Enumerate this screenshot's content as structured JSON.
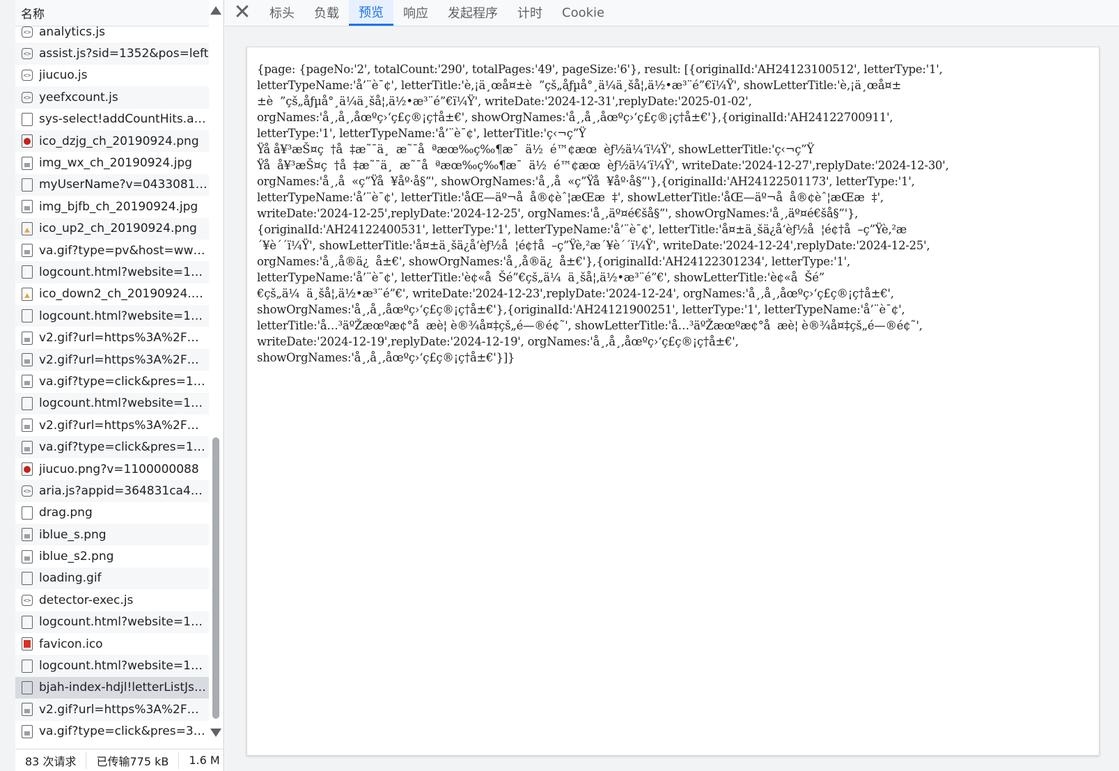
{
  "network": {
    "column_header": "名称",
    "requests": [
      {
        "name": "analytics.js",
        "icon": "script-icon",
        "type": "script"
      },
      {
        "name": "assist.js?sid=1352&pos=left",
        "icon": "script-icon",
        "type": "script"
      },
      {
        "name": "jiucuo.js",
        "icon": "script-icon",
        "type": "script"
      },
      {
        "name": "yeefxcount.js",
        "icon": "script-icon",
        "type": "script"
      },
      {
        "name": "sys-select!addCountHits.acti...",
        "icon": "document-icon",
        "type": "doc"
      },
      {
        "name": "ico_dzjg_ch_20190924.png",
        "icon": "image-icon",
        "type": "img-red"
      },
      {
        "name": "img_wx_ch_20190924.jpg",
        "icon": "image-icon",
        "type": "img"
      },
      {
        "name": "myUserName?v=043308105...",
        "icon": "document-icon",
        "type": "doc"
      },
      {
        "name": "img_bjfb_ch_20190924.jpg",
        "icon": "image-icon",
        "type": "img"
      },
      {
        "name": "ico_up2_ch_20190924.png",
        "icon": "image-icon",
        "type": "img-gold"
      },
      {
        "name": "va.gif?type=pv&host=www....",
        "icon": "image-icon",
        "type": "img"
      },
      {
        "name": "logcount.html?website=100...",
        "icon": "document-icon",
        "type": "doc"
      },
      {
        "name": "ico_down2_ch_20190924.png",
        "icon": "image-icon",
        "type": "img-gold"
      },
      {
        "name": "logcount.html?website=100...",
        "icon": "document-icon",
        "type": "doc"
      },
      {
        "name": "v2.gif?url=https%3A%2F%2...",
        "icon": "image-icon",
        "type": "img"
      },
      {
        "name": "v2.gif?url=https%3A%2F%2...",
        "icon": "image-icon",
        "type": "img"
      },
      {
        "name": "va.gif?type=click&pres=123...",
        "icon": "image-icon",
        "type": "img"
      },
      {
        "name": "logcount.html?website=100...",
        "icon": "document-icon",
        "type": "doc"
      },
      {
        "name": "v2.gif?url=https%3A%2F%2...",
        "icon": "image-icon",
        "type": "img"
      },
      {
        "name": "va.gif?type=click&pres=123...",
        "icon": "image-icon",
        "type": "img"
      },
      {
        "name": "jiucuo.png?v=1100000088",
        "icon": "image-icon",
        "type": "img-red"
      },
      {
        "name": "aria.js?appid=364831ca496...",
        "icon": "script-icon",
        "type": "script"
      },
      {
        "name": "drag.png",
        "icon": "image-icon",
        "type": "doc"
      },
      {
        "name": "iblue_s.png",
        "icon": "image-icon",
        "type": "img"
      },
      {
        "name": "iblue_s2.png",
        "icon": "image-icon",
        "type": "img"
      },
      {
        "name": "loading.gif",
        "icon": "image-icon",
        "type": "doc"
      },
      {
        "name": "detector-exec.js",
        "icon": "script-icon",
        "type": "script"
      },
      {
        "name": "logcount.html?website=100...",
        "icon": "document-icon",
        "type": "doc"
      },
      {
        "name": "favicon.ico",
        "icon": "image-icon",
        "type": "ico-red"
      },
      {
        "name": "logcount.html?website=100...",
        "icon": "document-icon",
        "type": "doc"
      },
      {
        "name": "bjah-index-hdjl!letterListJso...",
        "icon": "document-icon",
        "type": "doc",
        "selected": true
      },
      {
        "name": "v2.gif?url=https%3A%2F%2...",
        "icon": "image-icon",
        "type": "img"
      },
      {
        "name": "va.gif?type=click&pres=397...",
        "icon": "image-icon",
        "type": "img"
      }
    ],
    "status": {
      "requests": "83 次请求",
      "transferred": "已传输775 kB",
      "resources": "1.6 M"
    }
  },
  "detail": {
    "close_icon": "close-icon",
    "tabs": [
      "标头",
      "负载",
      "预览",
      "响应",
      "发起程序",
      "计时",
      "Cookie"
    ],
    "active_tab": "预览",
    "preview_lines": [
      "{page: {pageNo:'2', totalCount:'290', totalPages:'49', pageSize:'6'}, result: [{originalId:'AH24123100512', letterType:'1',",
      "letterTypeName:'å’¨è¯¢', letterTitle:'è‚¡ä¸œå¤±è  ”çš„åƒµå°¸ä¼ä¸šå¦‚ä½•æ³¨é”€ï¼Ÿ', showLetterTitle:'è‚¡ä¸œå¤±",
      "±è  ”çš„åƒµå°¸ä¼ä¸šå¦‚ä½•æ³¨é”€ï¼Ÿ', writeDate:'2024-12-31',replyDate:'2025-01-02',",
      "orgNames:'å¸‚å¸‚åœºç›‘ç£ç®¡ç†å±€', showOrgNames:'å¸‚å¸‚åœºç›‘ç£ç®¡ç†å±€'},{originalId:'AH24122700911',",
      "letterType:'1', letterTypeName:'å’¨è¯¢', letterTitle:'ç‹¬ç”Ÿ",
      "Ÿå å¥³æŠ¤ç  †å  ‡æ˜¯ä¸  æ˜¯å  ªæœ‰ç‰¶æ¯  ä½  é™¢æœ  èƒ½ä¼‘ï¼Ÿ', showLetterTitle:'ç‹¬ç”Ÿ",
      "Ÿå  å¥³æŠ¤ç  †å  ‡æ˜¯ä¸  æ˜¯å  ªæœ‰ç‰¶æ¯  ä½  é™¢æœ  èƒ½ä¼‘ï¼Ÿ', writeDate:'2024-12-27',replyDate:'2024-12-30',",
      "orgNames:'å¸‚å  «ç”Ÿå  ¥åº·å§”', showOrgNames:'å¸‚å  «ç”Ÿå  ¥åº·å§”'},{originalId:'AH24122501173', letterType:'1',",
      "letterTypeName:'å’¨è¯¢', letterTitle:'åŒ—äº¬å  å®¢èˆ¦æŒæ  ‡', showLetterTitle:'åŒ—äº¬å  å®¢èˆ¦æŒæ  ‡',",
      "writeDate:'2024-12-25',replyDate:'2024-12-25', orgNames:'å¸‚äº¤é€šå§”', showOrgNames:'å¸‚äº¤é€šå§”'},",
      "{originalId:'AH24122400531', letterType:'1', letterTypeName:'å’¨è¯¢', letterTitle:'å¤±ä¸šä¿å‘èƒ½å  ¦é¢†å  –ç”Ÿè‚²æ",
      "´¥è´´ï¼Ÿ', showLetterTitle:'å¤±ä¸šä¿å‘èƒ½å  ¦é¢†å  –ç”Ÿè‚²æ´¥è´´ï¼Ÿ', writeDate:'2024-12-24',replyDate:'2024-12-25',",
      "orgNames:'å¸‚å®ä¿  å±€', showOrgNames:'å¸‚å®ä¿  å±€'},{originalId:'AH24122301234', letterType:'1',",
      "letterTypeName:'å’¨è¯¢', letterTitle:'è¢«å  Šé”€çš„ä¼  ä¸šå¦‚ä½•æ³¨é”€', showLetterTitle:'è¢«å  Šé”",
      "€çš„ä¼  ä¸šå¦‚ä½•æ³¨é”€', writeDate:'2024-12-23',replyDate:'2024-12-24', orgNames:'å¸‚å¸‚åœºç›‘ç£ç®¡ç†å±€',",
      "showOrgNames:'å¸‚å¸‚åœºç›‘ç£ç®¡ç†å±€'},{originalId:'AH24121900251', letterType:'1', letterTypeName:'å’¨è¯¢',",
      "letterTitle:'å…³äºŽæœºæ¢°å  æè¦ è®¾å¤‡çš„é—®é¢˜', showLetterTitle:'å…³äºŽæœºæ¢°å  æè¦ è®¾å¤‡çš„é—®é¢˜',",
      "writeDate:'2024-12-19',replyDate:'2024-12-19', orgNames:'å¸‚å¸‚åœºç›‘ç£ç®¡ç†å±€',",
      "showOrgNames:'å¸‚å¸‚åœºç›‘ç£ç®¡ç†å±€'}]}"
    ]
  }
}
